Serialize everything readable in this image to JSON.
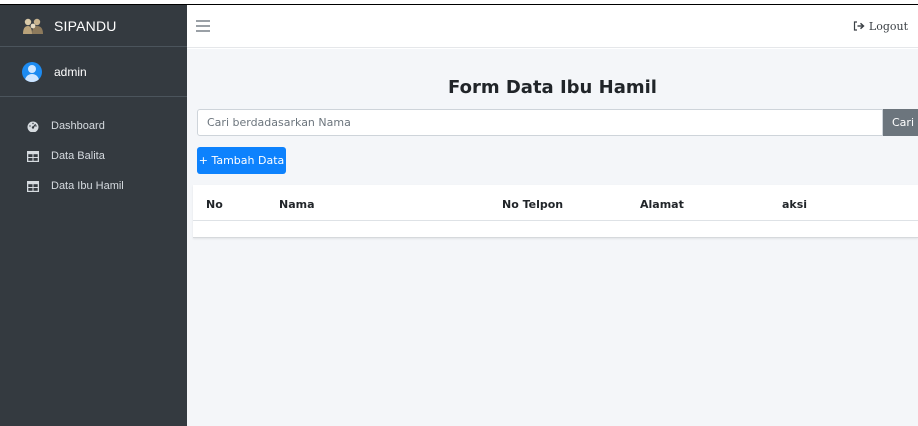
{
  "brand": {
    "name": "SIPANDU",
    "logo_icon": "group-logo-icon"
  },
  "user": {
    "name": "admin",
    "avatar_icon": "user-avatar-icon"
  },
  "sidebar": {
    "items": [
      {
        "label": "Dashboard",
        "icon": "tachometer-icon"
      },
      {
        "label": "Data Balita",
        "icon": "table-icon"
      },
      {
        "label": "Data Ibu Hamil",
        "icon": "table-icon"
      }
    ]
  },
  "topbar": {
    "menu_icon": "hamburger-icon",
    "logout_label": "Logout",
    "logout_icon": "sign-out-icon"
  },
  "main": {
    "title": "Form Data Ibu Hamil",
    "search": {
      "placeholder": "Cari berdadasarkan Nama",
      "button_label": "Cari"
    },
    "add_button_label": "+ Tambah Data",
    "table": {
      "columns": [
        "No",
        "Nama",
        "No Telpon",
        "Alamat",
        "aksi"
      ],
      "rows": []
    }
  },
  "colors": {
    "sidebar_bg": "#343a40",
    "content_bg": "#f4f6f9",
    "primary_button": "#0d82fd",
    "secondary_button": "#6c757d"
  }
}
